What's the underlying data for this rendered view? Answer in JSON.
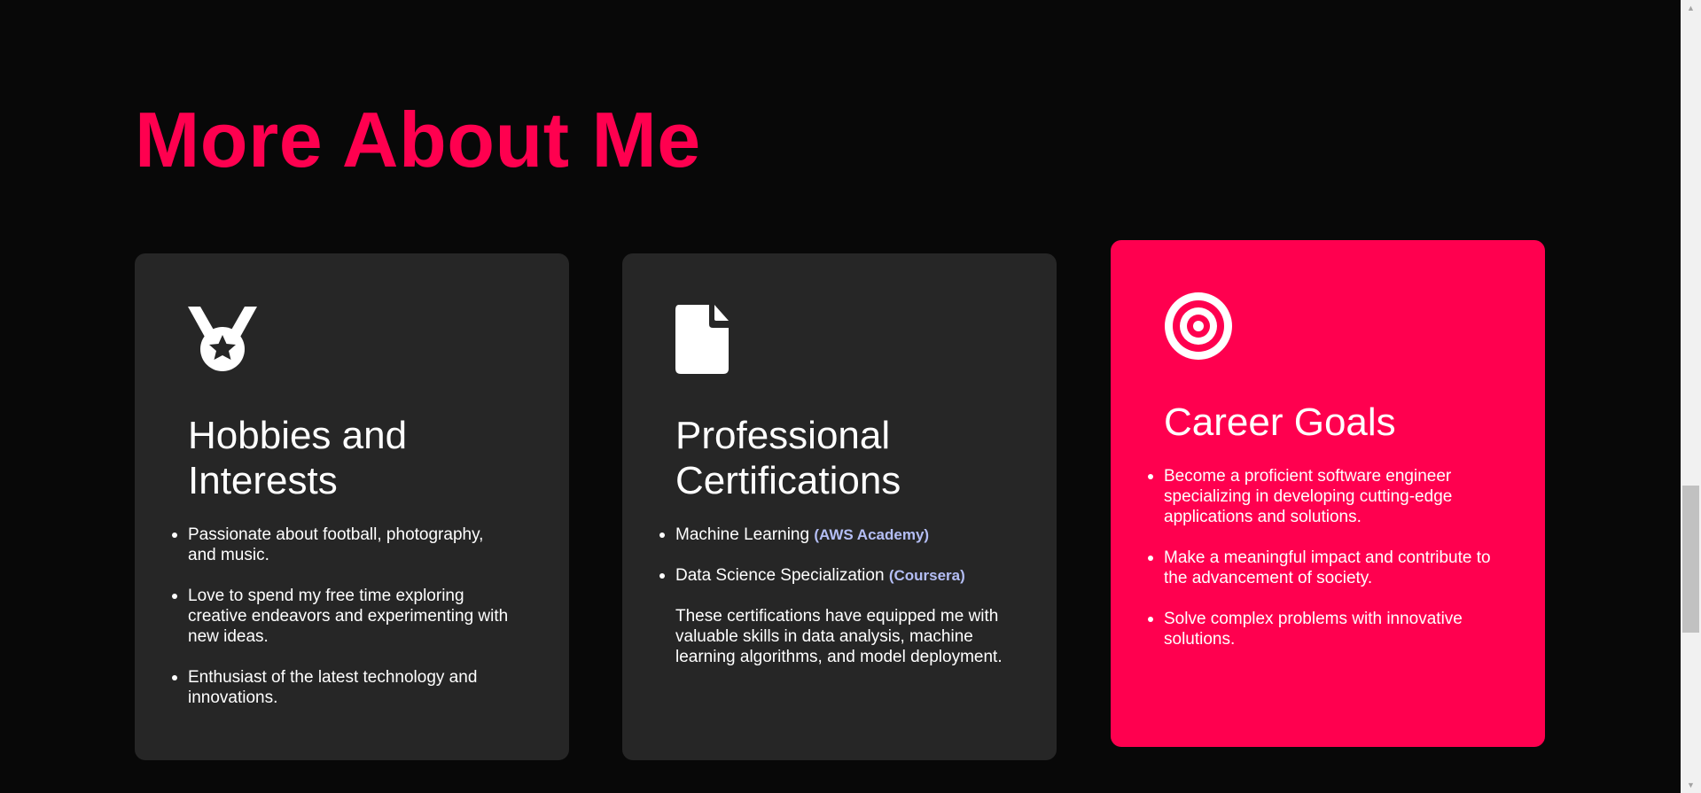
{
  "section": {
    "title": "More About Me"
  },
  "cards": [
    {
      "icon": "medal-icon",
      "title": "Hobbies and Interests",
      "items": [
        "Passionate about football, photography, and music.",
        "Love to spend my free time exploring creative endeavors and experimenting with new ideas.",
        "Enthusiast of the latest technology and innovations."
      ]
    },
    {
      "icon": "document-icon",
      "title": "Professional Certifications",
      "items": [
        {
          "name": "Machine Learning",
          "provider": "(AWS Academy)"
        },
        {
          "name": "Data Science Specialization",
          "provider": "(Coursera)"
        }
      ],
      "note": "These certifications have equipped me with valuable skills in data analysis, machine learning algorithms, and model deployment."
    },
    {
      "icon": "target-icon",
      "title": "Career Goals",
      "items": [
        "Become a proficient software engineer specializing in developing cutting-edge applications and solutions.",
        "Make a meaningful impact and contribute to the advancement of society.",
        "Solve complex problems with innovative solutions."
      ]
    }
  ],
  "colors": {
    "accent": "#ff004f",
    "card_background": "#262626",
    "page_background": "#080808",
    "provider_text": "#b4bef5"
  }
}
